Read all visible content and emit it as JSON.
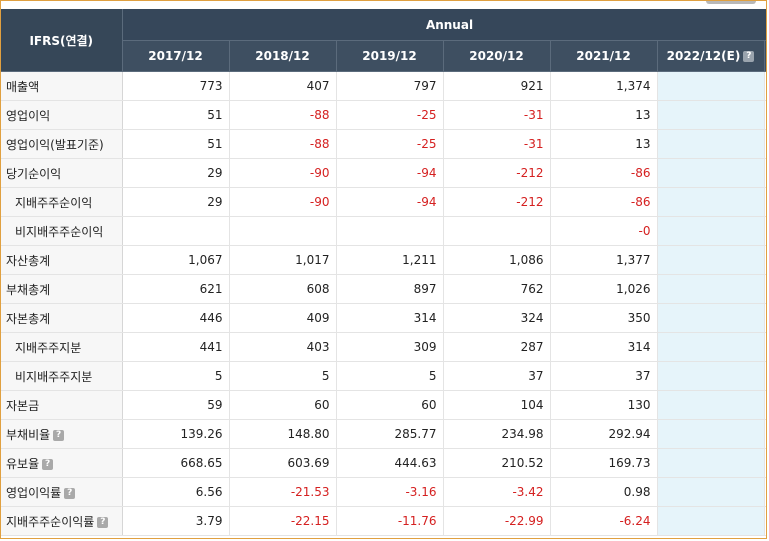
{
  "header": {
    "corner_label": "IFRS(연결)",
    "annual_label": "Annual",
    "periods": [
      "2017/12",
      "2018/12",
      "2019/12",
      "2020/12",
      "2021/12",
      "2022/12(E)"
    ],
    "help_glyph": "?"
  },
  "rows": [
    {
      "label": "매출액",
      "values": [
        "773",
        "407",
        "797",
        "921",
        "1,374",
        ""
      ]
    },
    {
      "label": "영업이익",
      "values": [
        "51",
        "-88",
        "-25",
        "-31",
        "13",
        ""
      ]
    },
    {
      "label": "영업이익(발표기준)",
      "values": [
        "51",
        "-88",
        "-25",
        "-31",
        "13",
        ""
      ]
    },
    {
      "label": "당기순이익",
      "values": [
        "29",
        "-90",
        "-94",
        "-212",
        "-86",
        ""
      ]
    },
    {
      "label": "지배주주순이익",
      "values": [
        "29",
        "-90",
        "-94",
        "-212",
        "-86",
        ""
      ]
    },
    {
      "label": "비지배주주순이익",
      "values": [
        "",
        "",
        "",
        "",
        "-0",
        ""
      ]
    },
    {
      "label": "자산총계",
      "values": [
        "1,067",
        "1,017",
        "1,211",
        "1,086",
        "1,377",
        ""
      ]
    },
    {
      "label": "부채총계",
      "values": [
        "621",
        "608",
        "897",
        "762",
        "1,026",
        ""
      ]
    },
    {
      "label": "자본총계",
      "values": [
        "446",
        "409",
        "314",
        "324",
        "350",
        ""
      ]
    },
    {
      "label": "지배주주지분",
      "values": [
        "441",
        "403",
        "309",
        "287",
        "314",
        ""
      ]
    },
    {
      "label": "비지배주주지분",
      "values": [
        "5",
        "5",
        "5",
        "37",
        "37",
        ""
      ]
    },
    {
      "label": "자본금",
      "values": [
        "59",
        "60",
        "60",
        "104",
        "130",
        ""
      ]
    },
    {
      "label": "부채비율",
      "values": [
        "139.26",
        "148.80",
        "285.77",
        "234.98",
        "292.94",
        ""
      ]
    },
    {
      "label": "유보율",
      "values": [
        "668.65",
        "603.69",
        "444.63",
        "210.52",
        "169.73",
        ""
      ]
    },
    {
      "label": "영업이익률",
      "values": [
        "6.56",
        "-21.53",
        "-3.16",
        "-3.42",
        "0.98",
        ""
      ]
    },
    {
      "label": "지배주주순이익률",
      "values": [
        "3.79",
        "-22.15",
        "-11.76",
        "-22.99",
        "-6.24",
        ""
      ]
    }
  ],
  "colors": {
    "header_bg": "#36475a",
    "negative": "#d52020",
    "estimate_bg": "#e6f4fa",
    "frame_border": "#e0a040"
  }
}
